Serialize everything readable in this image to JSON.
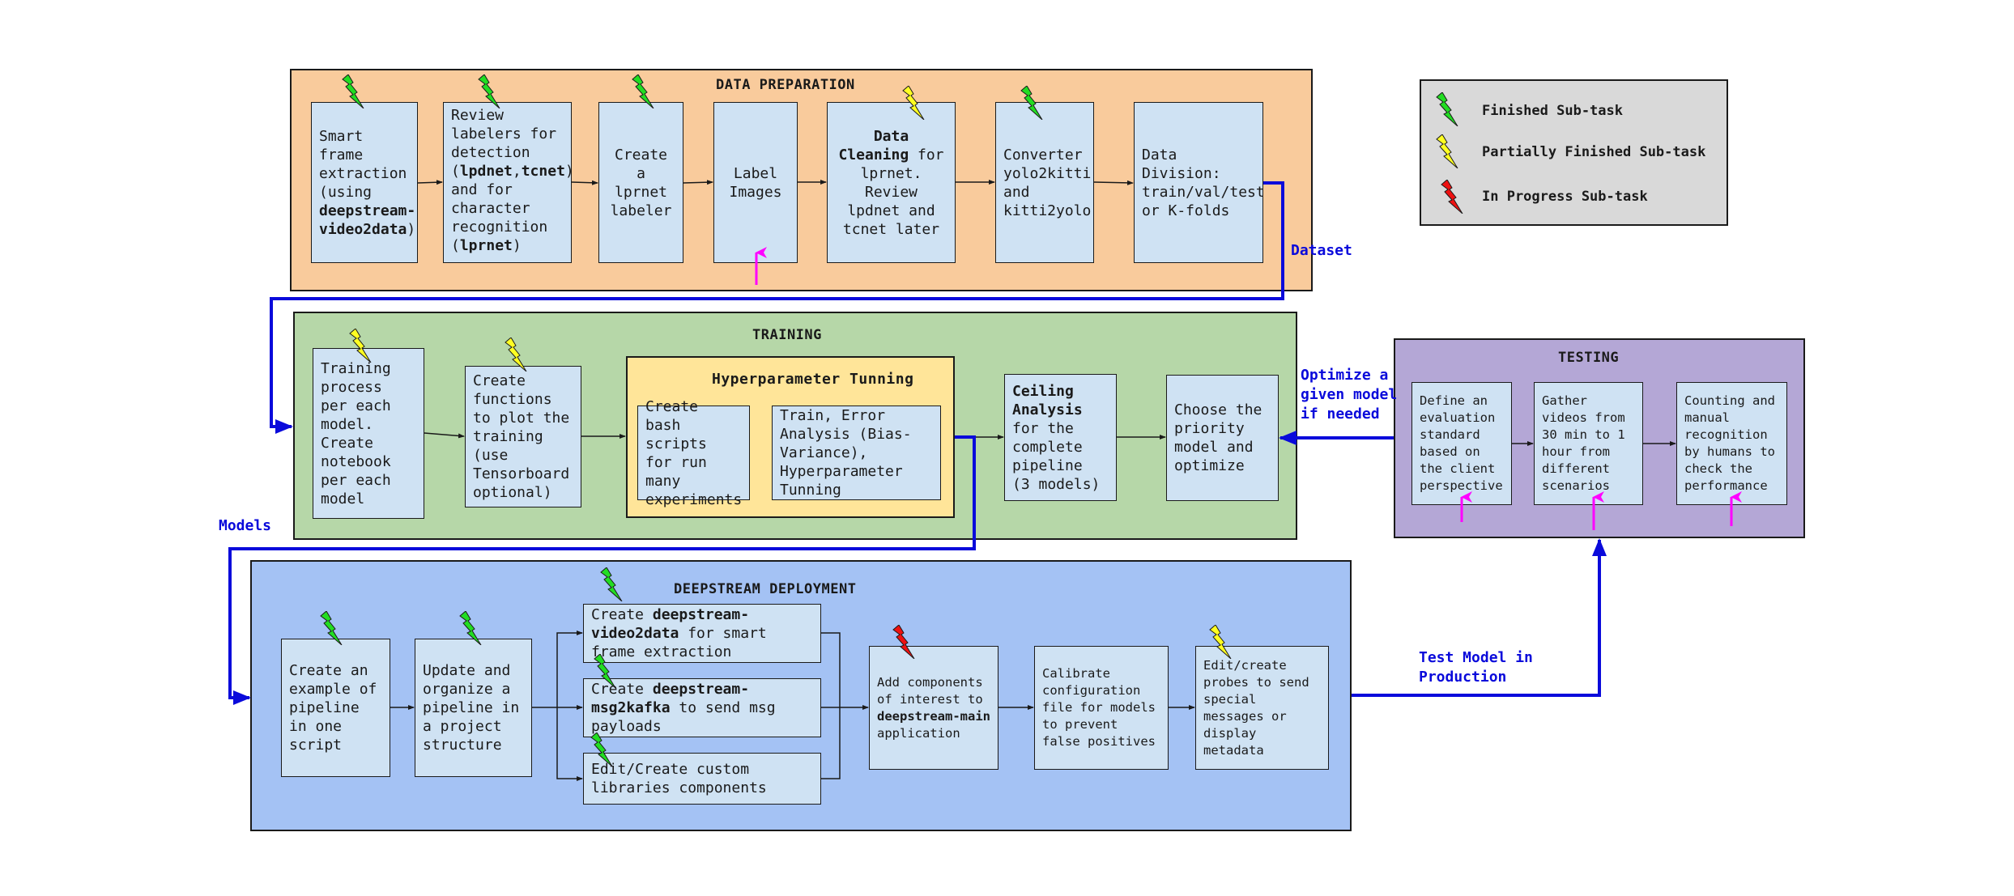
{
  "colors": {
    "data_preparation_bg": "#f9cb9c",
    "training_bg": "#b6d7a8",
    "hyperparameter_bg": "#ffe599",
    "testing_bg": "#b4a7d6",
    "deployment_bg": "#a4c2f4",
    "task_bg": "#cfe2f3",
    "legend_bg": "#d9d9d9",
    "flow_blue": "#0a0adb",
    "pointer_magenta": "#ff00ff",
    "status_finished": "#22dd22",
    "status_partial": "#ffff22",
    "status_in_progress": "#ee1111"
  },
  "legend": {
    "items": [
      {
        "status": "finished",
        "label": "Finished Sub-task",
        "icon": "green-lightning-icon"
      },
      {
        "status": "partial",
        "label": "Partially Finished Sub-task",
        "icon": "yellow-lightning-icon"
      },
      {
        "status": "in_progress",
        "label": "In Progress Sub-task",
        "icon": "red-lightning-icon"
      }
    ]
  },
  "data_preparation": {
    "title": "DATA PREPARATION",
    "tasks": [
      {
        "id": "smart-frame",
        "status": "finished",
        "parts": [
          [
            "Smart frame extraction (using ",
            false
          ],
          [
            "deepstream-video2data",
            true
          ],
          [
            ")",
            false
          ]
        ]
      },
      {
        "id": "review-labelers",
        "status": "finished",
        "parts": [
          [
            "Review labelers for detection (",
            false
          ],
          [
            "lpdnet",
            true
          ],
          [
            ",",
            false
          ],
          [
            "tcnet",
            true
          ],
          [
            ") and for character recognition (",
            false
          ],
          [
            "lprnet",
            true
          ],
          [
            ")",
            false
          ]
        ]
      },
      {
        "id": "lprnet-labeler",
        "status": "finished",
        "parts": [
          [
            "Create a lprnet labeler",
            false
          ]
        ]
      },
      {
        "id": "label-images",
        "status": "none",
        "parts": [
          [
            "Label Images",
            false
          ]
        ]
      },
      {
        "id": "data-cleaning",
        "status": "partial",
        "parts": [
          [
            "Data Cleaning",
            true
          ],
          [
            " for lprnet. Review lpdnet and tcnet later",
            false
          ]
        ]
      },
      {
        "id": "converter",
        "status": "finished",
        "parts": [
          [
            "Converter yolo2kitti and kitti2yolo",
            false
          ]
        ]
      },
      {
        "id": "data-division",
        "status": "none",
        "parts": [
          [
            "Data Division: train/val/test or K-folds",
            false
          ]
        ]
      }
    ]
  },
  "training": {
    "title": "TRAINING",
    "hyperparameter_title": "Hyperparameter Tunning",
    "tasks": [
      {
        "id": "training-process",
        "status": "partial",
        "parts": [
          [
            "Training process per each model. Create notebook per each model",
            false
          ]
        ]
      },
      {
        "id": "plot-functions",
        "status": "partial",
        "parts": [
          [
            "Create functions to plot the training (use Tensorboard optional)",
            false
          ]
        ]
      },
      {
        "id": "bash-scripts",
        "status": "none",
        "parts": [
          [
            "Create bash scripts for run many experiments",
            false
          ]
        ]
      },
      {
        "id": "train-error-analysis",
        "status": "none",
        "parts": [
          [
            "Train, Error Analysis (Bias-Variance), Hyperparameter Tunning",
            false
          ]
        ]
      },
      {
        "id": "ceiling-analysis",
        "status": "none",
        "parts": [
          [
            "Ceiling Analysis",
            true
          ],
          [
            " for the complete pipeline (3 models)",
            false
          ]
        ]
      },
      {
        "id": "choose-priority",
        "status": "none",
        "parts": [
          [
            "Choose the priority model and optimize",
            false
          ]
        ]
      }
    ]
  },
  "testing": {
    "title": "TESTING",
    "tasks": [
      {
        "id": "evaluation-standard",
        "status": "none",
        "parts": [
          [
            "Define an evaluation standard based on the client perspective",
            false
          ]
        ]
      },
      {
        "id": "gather-videos",
        "status": "none",
        "parts": [
          [
            "Gather videos from 30 min to 1 hour from different scenarios",
            false
          ]
        ]
      },
      {
        "id": "manual-recognition",
        "status": "none",
        "parts": [
          [
            "Counting and manual recognition by humans to check the performance",
            false
          ]
        ]
      }
    ]
  },
  "deployment": {
    "title": "DEEPSTREAM DEPLOYMENT",
    "tasks": [
      {
        "id": "example-pipeline",
        "status": "finished",
        "parts": [
          [
            "Create an example of pipeline in one script",
            false
          ]
        ]
      },
      {
        "id": "organize-pipeline",
        "status": "finished",
        "parts": [
          [
            "Update and organize a pipeline in a project structure",
            false
          ]
        ]
      },
      {
        "id": "video2data",
        "status": "finished",
        "parts": [
          [
            "Create ",
            false
          ],
          [
            "deepstream-video2data",
            true
          ],
          [
            " for smart frame extraction",
            false
          ]
        ]
      },
      {
        "id": "msg2kafka",
        "status": "finished",
        "parts": [
          [
            "Create ",
            false
          ],
          [
            "deepstream-msg2kafka",
            true
          ],
          [
            " to send msg payloads",
            false
          ]
        ]
      },
      {
        "id": "custom-libraries",
        "status": "finished",
        "parts": [
          [
            "Edit/Create custom libraries components",
            false
          ]
        ]
      },
      {
        "id": "add-components",
        "status": "in_progress",
        "parts": [
          [
            "Add components of interest to ",
            false
          ],
          [
            "deepstream-main",
            true
          ],
          [
            " application",
            false
          ]
        ]
      },
      {
        "id": "calibrate-config",
        "status": "none",
        "parts": [
          [
            "Calibrate configuration file for models to prevent false positives",
            false
          ]
        ]
      },
      {
        "id": "edit-probes",
        "status": "partial",
        "parts": [
          [
            "Edit/create probes to send special messages or display metadata",
            false
          ]
        ]
      }
    ]
  },
  "flows": {
    "dataset": "Dataset",
    "models": "Models",
    "optimize_line1": "Optimize a",
    "optimize_line2": "given model",
    "optimize_line3": "if needed",
    "test_line1": "Test Model in",
    "test_line2": "Production"
  }
}
